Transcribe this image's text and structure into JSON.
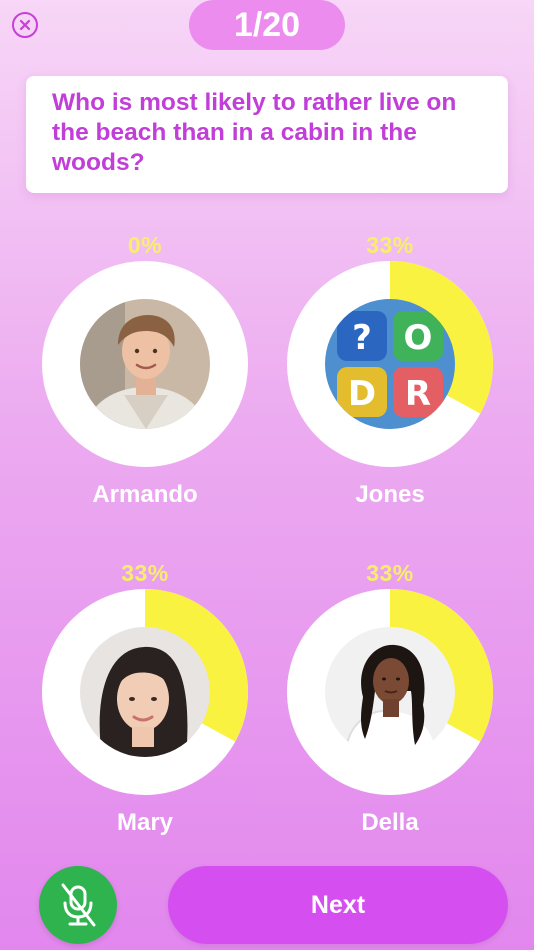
{
  "header": {
    "counter": "1/20"
  },
  "question": "Who is most likely to rather live on the beach than in a cabin in the woods?",
  "players": [
    {
      "name": "Armando",
      "percent_label": "0%",
      "vote_fraction": 0.0,
      "avatar": "photo-young-man-icon"
    },
    {
      "name": "Jones",
      "percent_label": "33%",
      "vote_fraction": 0.33,
      "avatar": "app-logo-qodr-icon",
      "logo_letters": [
        "?",
        "O",
        "D",
        "R"
      ]
    },
    {
      "name": "Mary",
      "percent_label": "33%",
      "vote_fraction": 0.33,
      "avatar": "photo-young-woman-icon"
    },
    {
      "name": "Della",
      "percent_label": "33%",
      "vote_fraction": 0.33,
      "avatar": "photo-woman-white-robe-icon"
    }
  ],
  "footer": {
    "next_label": "Next",
    "mic_state": "muted"
  },
  "colors": {
    "accent": "#d54ff0",
    "question_text": "#c13ed8",
    "percent": "#f8ee6a",
    "ring_fill": "#f9f241",
    "mic": "#2fb34f"
  }
}
